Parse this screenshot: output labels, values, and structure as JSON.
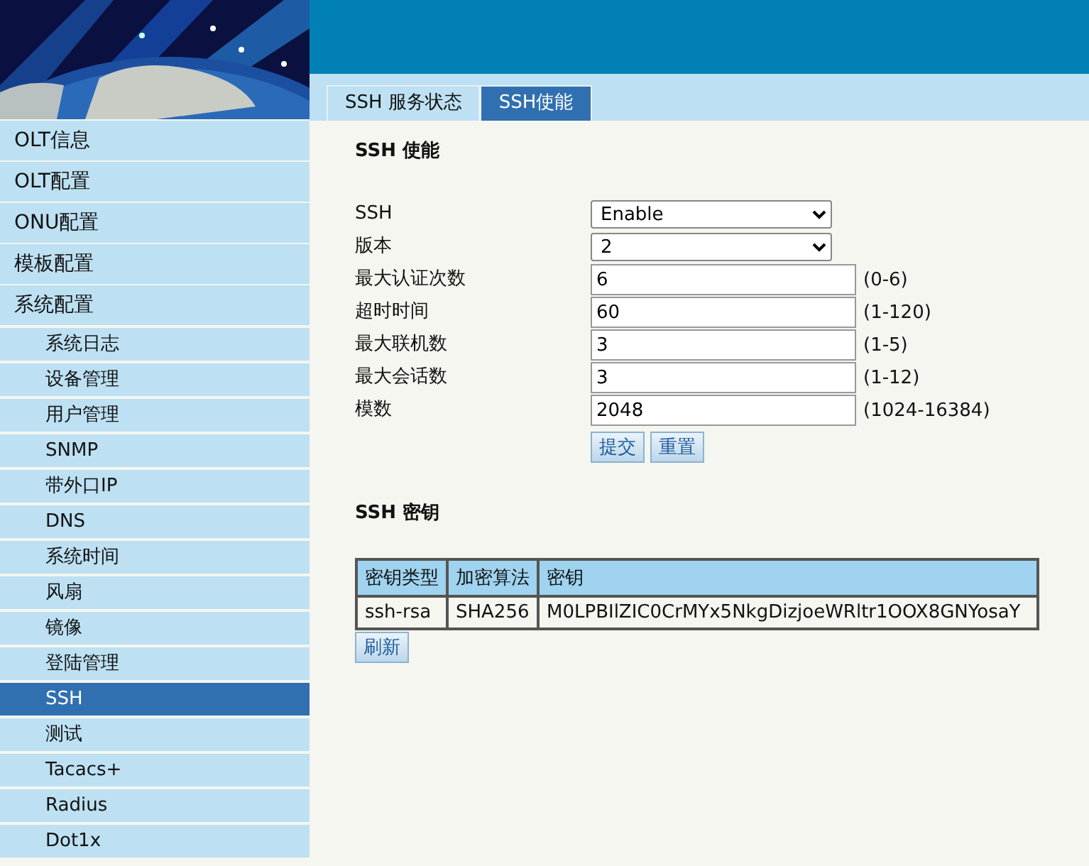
{
  "tabs": [
    {
      "label": "SSH 服务状态",
      "selected": false
    },
    {
      "label": "SSH使能",
      "selected": true
    }
  ],
  "sidebar": {
    "items": [
      {
        "label": "OLT信息",
        "selected": false
      },
      {
        "label": "OLT配置",
        "selected": false
      },
      {
        "label": "ONU配置",
        "selected": false
      },
      {
        "label": "模板配置",
        "selected": false
      },
      {
        "label": "系统配置",
        "selected": false,
        "children": [
          {
            "label": "系统日志",
            "selected": false
          },
          {
            "label": "设备管理",
            "selected": false
          },
          {
            "label": "用户管理",
            "selected": false
          },
          {
            "label": "SNMP",
            "selected": false
          },
          {
            "label": "带外口IP",
            "selected": false
          },
          {
            "label": "DNS",
            "selected": false
          },
          {
            "label": "系统时间",
            "selected": false
          },
          {
            "label": "风扇",
            "selected": false
          },
          {
            "label": "镜像",
            "selected": false
          },
          {
            "label": "登陆管理",
            "selected": false
          },
          {
            "label": "SSH",
            "selected": true
          },
          {
            "label": "测试",
            "selected": false
          },
          {
            "label": "Tacacs+",
            "selected": false
          },
          {
            "label": "Radius",
            "selected": false
          },
          {
            "label": "Dot1x",
            "selected": false
          }
        ]
      }
    ]
  },
  "settings": {
    "title": "SSH 使能",
    "fields": [
      {
        "kind": "select",
        "label": "SSH",
        "value": "Enable"
      },
      {
        "kind": "select",
        "label": "版本",
        "value": "2"
      },
      {
        "kind": "input",
        "label": "最大认证次数",
        "value": "6",
        "range": "(0-6)"
      },
      {
        "kind": "input",
        "label": "超时时间",
        "value": "60",
        "range": "(1-120)"
      },
      {
        "kind": "input",
        "label": "最大联机数",
        "value": "3",
        "range": "(1-5)"
      },
      {
        "kind": "input",
        "label": "最大会话数",
        "value": "3",
        "range": "(1-12)"
      },
      {
        "kind": "input",
        "label": "模数",
        "value": "2048",
        "range": "(1024-16384)"
      }
    ],
    "buttons": [
      "提交",
      "重置"
    ]
  },
  "keys": {
    "title": "SSH 密钥",
    "table": {
      "columns": [
        "密钥类型",
        "加密算法",
        "密钥"
      ],
      "rows": [
        [
          "ssh-rsa",
          "SHA256",
          "M0LPBIlZIC0CrMYx5NkgDizjoeWRltr1OOX8GNYosaY"
        ]
      ]
    },
    "buttons": [
      "刷新"
    ]
  }
}
